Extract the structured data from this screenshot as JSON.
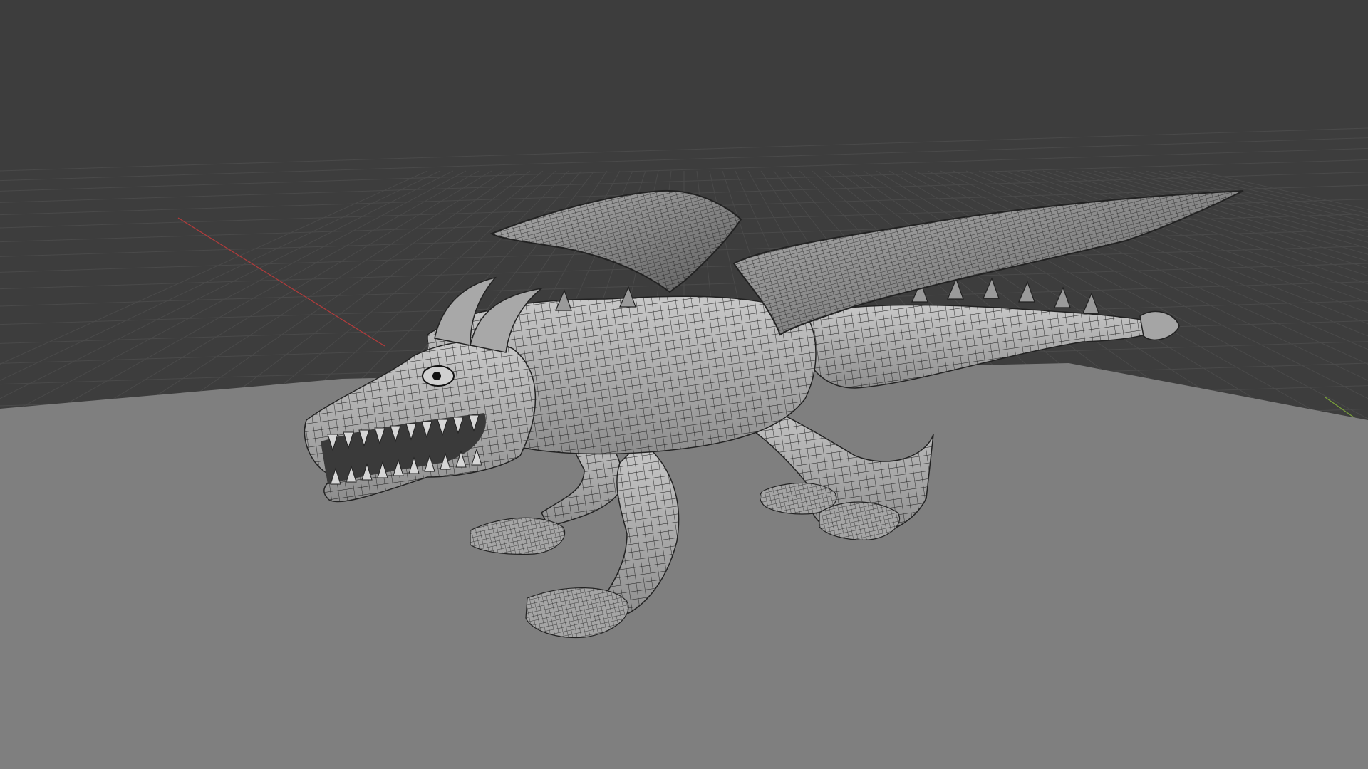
{
  "app": {
    "view": "3d-viewport",
    "shading": "solid-wireframe-overlay"
  },
  "viewport": {
    "background_color": "#3d3d3d",
    "grid_color": "#4a4a4a",
    "ground_plane_color": "#7f7f7f",
    "x_axis_color": "#b23b3b",
    "y_axis_color": "#7aa33a",
    "mesh_fill_color": "#b4b4b4",
    "wire_color": "#1c1c1c"
  },
  "object": {
    "kind": "dragon-mesh"
  }
}
